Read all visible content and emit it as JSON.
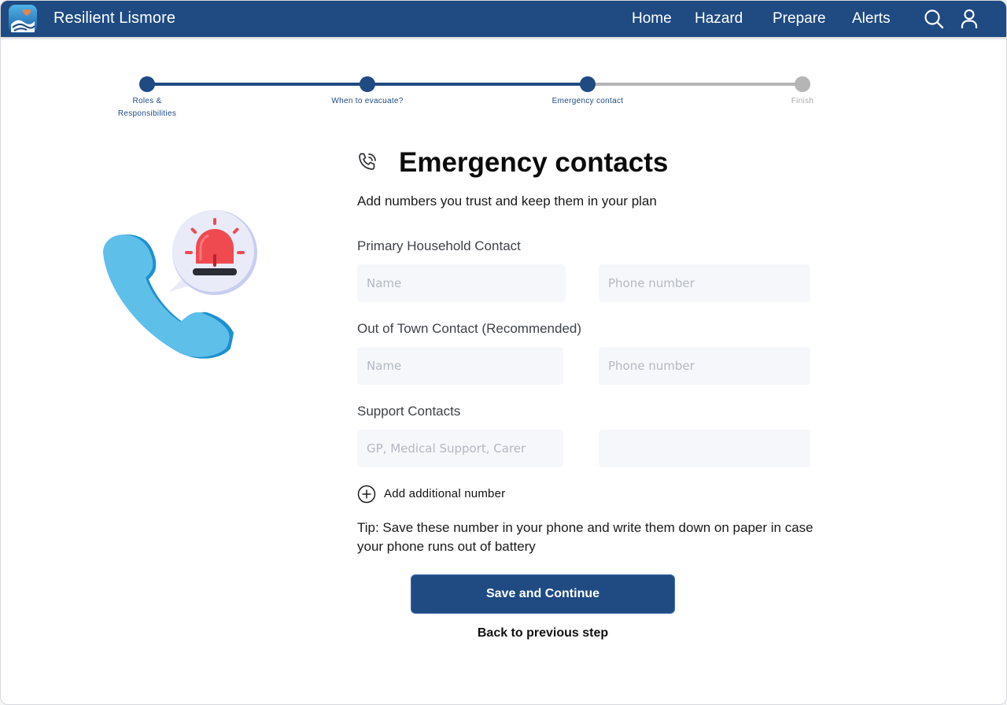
{
  "app": {
    "name": "Resilient Lismore"
  },
  "nav": {
    "links": [
      "Home",
      "Hazard",
      "Prepare",
      "Alerts"
    ],
    "icons": [
      "search-icon",
      "user-icon"
    ]
  },
  "stepper": {
    "steps": [
      {
        "label": "Roles & Responsibilities",
        "state": "complete"
      },
      {
        "label": "When to evacuate?",
        "state": "complete"
      },
      {
        "label": "Emergency contact",
        "state": "current"
      },
      {
        "label": "Finish",
        "state": "upcoming"
      }
    ]
  },
  "page": {
    "title": "Emergency contacts",
    "subtitle": "Add numbers you trust and keep them in your plan",
    "title_icon": "phone-call-icon"
  },
  "form": {
    "groups": [
      {
        "label": "Primary Household Contact",
        "name_placeholder": "Name",
        "phone_placeholder": "Phone number"
      },
      {
        "label": "Out of Town Contact (Recommended)",
        "name_placeholder": "Name",
        "phone_placeholder": "Phone number"
      },
      {
        "label": "Support Contacts",
        "name_placeholder": "GP, Medical Support, Carer",
        "phone_placeholder": ""
      }
    ],
    "add_label": "Add additional number",
    "tip": "Tip: Save these number in your phone and write them down on paper in case your phone runs out of battery",
    "save_label": "Save and Continue",
    "back_label": "Back to previous step"
  },
  "colors": {
    "brand": "#1f4a82",
    "step_inactive": "#b5b5b5",
    "field_bg": "#f6f7fa"
  }
}
